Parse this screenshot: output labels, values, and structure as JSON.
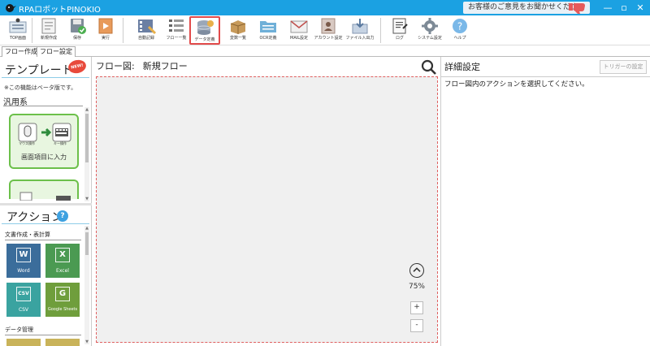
{
  "window": {
    "title": "RPAロボットPINOKIO",
    "feedback_label": "お客様のご意見をお聞かせください",
    "minimize_glyph": "—",
    "maximize_glyph": "▫",
    "close_glyph": "✕"
  },
  "toolbar": {
    "items": [
      {
        "label": "TOP画面",
        "icon": "home-icon"
      },
      {
        "label": "新規作成",
        "icon": "new-file-icon"
      },
      {
        "label": "保存",
        "icon": "save-icon"
      },
      {
        "label": "実行",
        "icon": "run-icon"
      },
      {
        "label": "自動記録",
        "icon": "film-icon"
      },
      {
        "label": "フロー一覧",
        "icon": "list-icon"
      },
      {
        "label": "データ定義",
        "icon": "database-icon",
        "active": true
      },
      {
        "label": "変数一覧",
        "icon": "box-icon"
      },
      {
        "label": "OCR定義",
        "icon": "folder-icon"
      },
      {
        "label": "MAIL設定",
        "icon": "mail-icon"
      },
      {
        "label": "アカウント設定",
        "icon": "account-icon"
      },
      {
        "label": "ファイル入出力",
        "icon": "file-io-icon"
      },
      {
        "label": "ログ",
        "icon": "log-icon"
      },
      {
        "label": "システム設定",
        "icon": "gear-icon"
      },
      {
        "label": "ヘルプ",
        "icon": "help-icon"
      }
    ]
  },
  "mode_tabs": {
    "flow_create": "フロー作成",
    "flow_settings": "フロー設定"
  },
  "templates": {
    "title": "テンプレート",
    "new_badge": "NEW!",
    "beta_note": "※この機能はベータ版です。",
    "category": "汎用系",
    "card1": {
      "label": "画面項目に入力",
      "mouse_label": "マウス操作",
      "key_label": "キー操作"
    }
  },
  "actions": {
    "title": "アクション",
    "help_glyph": "?",
    "category_office": "文書作成・表計算",
    "category_data": "データ管理",
    "tiles": [
      {
        "badge": "W",
        "label": "Word",
        "color": "#3b6d9b"
      },
      {
        "badge": "X",
        "label": "Excel",
        "color": "#4b9a52"
      },
      {
        "badge": "CSV",
        "label": "CSV",
        "color": "#3aa3a0"
      },
      {
        "badge": "G",
        "label": "Google Sheets",
        "color": "#6f9e3c"
      }
    ]
  },
  "flow": {
    "label": "フロー図:",
    "name": "新規フロー",
    "zoom": "75%",
    "zoom_in": "+",
    "zoom_out": "-"
  },
  "details": {
    "title": "詳細設定",
    "trigger_button": "トリガーの設定",
    "message": "フロー図内のアクションを選択してください。"
  },
  "colors": {
    "titlebar": "#1ba1e2",
    "accent_green": "#6cc04a",
    "highlight_red": "#e24b4b"
  }
}
